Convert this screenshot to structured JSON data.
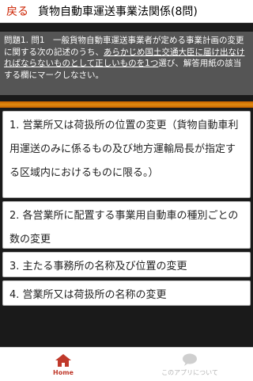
{
  "header": {
    "back_label": "戻る",
    "title": "貨物自動車運送事業法関係(8問)"
  },
  "question": {
    "prefix": "問題1. 問1　一般貨物自動車運送事業者が定める事業計画の変更に関する次の記述のうち、",
    "underlined": "あらかじめ国土交通大臣に届け出なければならないものとして正しいものを1つ",
    "suffix": "選び、解答用紙の該当する欄にマークしなさい。"
  },
  "choices": [
    {
      "label": "1. 営業所又は荷扱所の位置の変更（貨物自動車利用運送のみに係るもの及び地方運輸局長が指定する区域内におけるものに限る。）"
    },
    {
      "label": "2. 各営業所に配置する事業用自動車の種別ごとの数の変更"
    },
    {
      "label": "3. 主たる事務所の名称及び位置の変更"
    },
    {
      "label": "4. 営業所又は荷扱所の名称の変更"
    }
  ],
  "tabs": [
    {
      "label": "Home",
      "icon": "home-icon",
      "active": true
    },
    {
      "label": "このアプリについて",
      "icon": "chat-bubble-icon",
      "active": false
    }
  ],
  "colors": {
    "accent": "#c0392b",
    "question_bg": "#555555",
    "orange_bar": "#e08a10"
  }
}
